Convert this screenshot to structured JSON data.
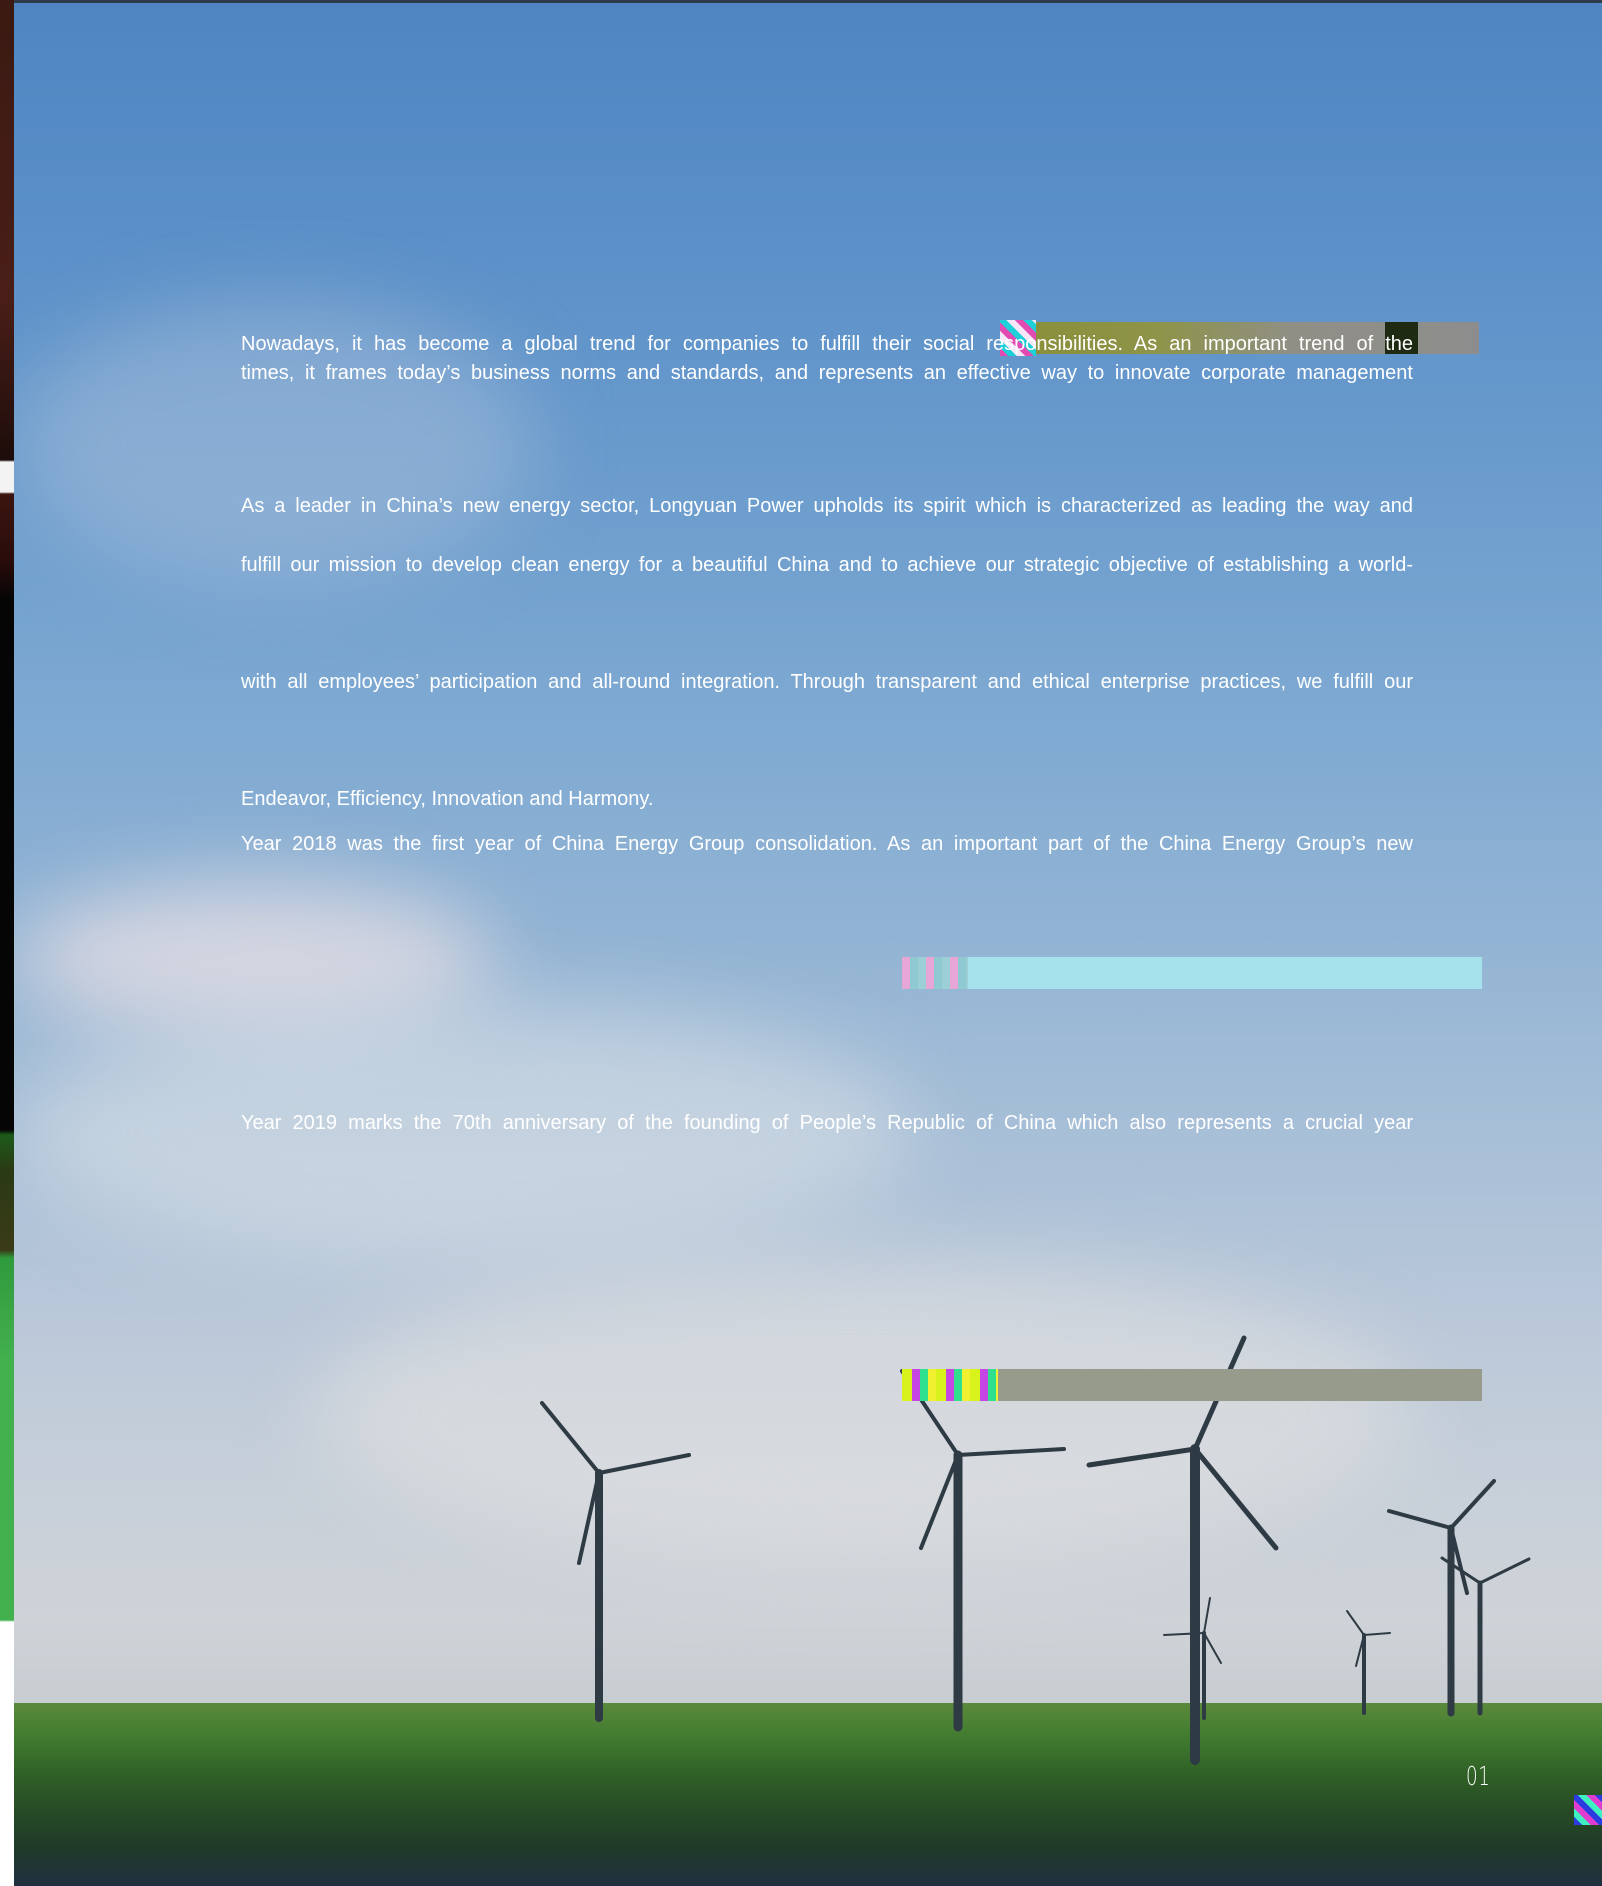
{
  "page": {
    "paragraphs": [
      "Nowadays, it has become a global trend for companies to fulfill their social responsibilities. As an important trend of the",
      "times, it frames today’s business norms and standards, and represents an effective way to innovate corporate management",
      "As a leader in China’s new energy sector, Longyuan Power upholds its spirit which is characterized as leading the way and",
      "fulfill our mission to develop clean energy for a beautiful China and to achieve our strategic objective of establishing a world-",
      "with all employees’ participation and all-round integration. Through transparent and ethical enterprise practices, we fulfill our",
      "Endeavor, Efficiency, Innovation and Harmony.",
      "Year 2018 was the first year of China Energy Group consolidation. As an important part of the China Energy Group’s new",
      "Year 2019 marks the 70th anniversary of the founding of People’s Republic of China which also represents a crucial year"
    ],
    "page_number": "01"
  }
}
